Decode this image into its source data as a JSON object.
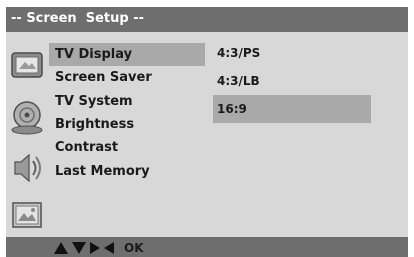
{
  "header": {
    "title": "-- Screen  Setup --"
  },
  "menu": {
    "items": [
      {
        "label": "TV Display",
        "selected": true
      },
      {
        "label": "Screen Saver",
        "selected": false
      },
      {
        "label": "TV System",
        "selected": false
      },
      {
        "label": "Brightness",
        "selected": false
      },
      {
        "label": "Contrast",
        "selected": false
      },
      {
        "label": "Last Memory",
        "selected": false
      }
    ]
  },
  "options": {
    "items": [
      {
        "label": "4:3/PS",
        "selected": false
      },
      {
        "label": "4:3/LB",
        "selected": false
      },
      {
        "label": "16:9",
        "selected": true
      }
    ]
  },
  "footer": {
    "nav_icons": [
      "up-arrow-icon",
      "down-arrow-icon",
      "right-arrow-icon",
      "left-arrow-icon"
    ],
    "ok_label": "OK"
  },
  "side_icons": [
    "tv-screen-icon",
    "disc-icon",
    "audio-icon",
    "picture-icon"
  ],
  "colors": {
    "bar": "#6e6e6e",
    "panel": "#d8d8d8",
    "highlight": "#a9a9a9",
    "text": "#1a1a1a",
    "title_text": "#ffffff"
  }
}
